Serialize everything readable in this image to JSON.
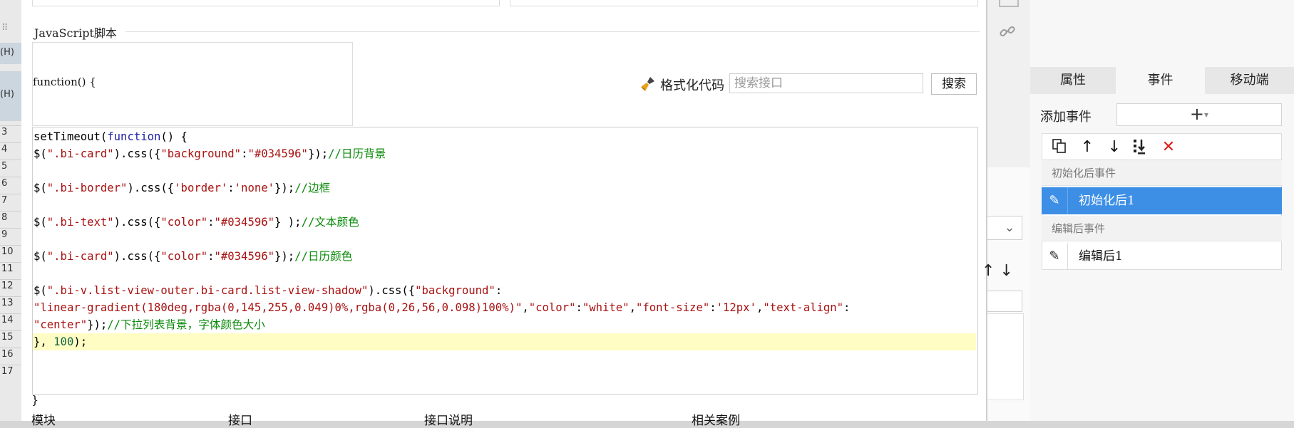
{
  "spreadsheet": {
    "header_cells": [
      "(H)",
      "(H)"
    ],
    "row_numbers": [
      "3",
      "4",
      "5",
      "6",
      "7",
      "8",
      "9",
      "10",
      "11",
      "12",
      "13",
      "14",
      "15",
      "16",
      "17"
    ]
  },
  "dialog": {
    "section_title": "JavaScript脚本",
    "function_signature": "function() {",
    "format_code_label": "格式化代码",
    "search": {
      "placeholder": "搜索接口",
      "value": ""
    },
    "search_button": "搜索",
    "code_lines": [
      [
        [
          "setTimeout(",
          "plain"
        ],
        [
          "function",
          "kw"
        ],
        [
          "() {",
          "plain"
        ]
      ],
      [
        [
          "$(",
          "plain"
        ],
        [
          "\".bi-card\"",
          "str"
        ],
        [
          ").css({",
          "plain"
        ],
        [
          "\"background\"",
          "str"
        ],
        [
          ":",
          "plain"
        ],
        [
          "\"#034596\"",
          "str"
        ],
        [
          "});",
          "plain"
        ],
        [
          "//日历背景",
          "com"
        ]
      ],
      [],
      [
        [
          "$(",
          "plain"
        ],
        [
          "\".bi-border\"",
          "str"
        ],
        [
          ").css({",
          "plain"
        ],
        [
          "'border'",
          "str"
        ],
        [
          ":",
          "plain"
        ],
        [
          "'none'",
          "str"
        ],
        [
          "});",
          "plain"
        ],
        [
          "//边框",
          "com"
        ]
      ],
      [],
      [
        [
          "$(",
          "plain"
        ],
        [
          "\".bi-text\"",
          "str"
        ],
        [
          ").css({",
          "plain"
        ],
        [
          "\"color\"",
          "str"
        ],
        [
          ":",
          "plain"
        ],
        [
          "\"#034596\"",
          "str"
        ],
        [
          "} );",
          "plain"
        ],
        [
          "//文本颜色",
          "com"
        ]
      ],
      [],
      [
        [
          "$(",
          "plain"
        ],
        [
          "\".bi-card\"",
          "str"
        ],
        [
          ").css({",
          "plain"
        ],
        [
          "\"color\"",
          "str"
        ],
        [
          ":",
          "plain"
        ],
        [
          "\"#034596\"",
          "str"
        ],
        [
          "});",
          "plain"
        ],
        [
          "//日历颜色",
          "com"
        ]
      ],
      [],
      [
        [
          "$(",
          "plain"
        ],
        [
          "\".bi-v.list-view-outer.bi-card.list-view-shadow\"",
          "str"
        ],
        [
          ").css({",
          "plain"
        ],
        [
          "\"background\"",
          "str"
        ],
        [
          ":",
          "plain"
        ]
      ],
      [
        [
          "\"linear-gradient(180deg,rgba(0,145,255,0.049)0%,rgba(0,26,56,0.098)100%)\"",
          "str"
        ],
        [
          ",",
          "plain"
        ],
        [
          "\"color\"",
          "str"
        ],
        [
          ":",
          "plain"
        ],
        [
          "\"white\"",
          "str"
        ],
        [
          ",",
          "plain"
        ],
        [
          "\"font-size\"",
          "str"
        ],
        [
          ":",
          "plain"
        ],
        [
          "'12px'",
          "str"
        ],
        [
          ",",
          "plain"
        ],
        [
          "\"text-align\"",
          "str"
        ],
        [
          ":",
          "plain"
        ]
      ],
      [
        [
          "\"center\"",
          "str"
        ],
        [
          "});",
          "plain"
        ],
        [
          "//下拉列表背景，字体颜色大小",
          "com"
        ]
      ],
      [
        [
          "}, ",
          "plain"
        ],
        [
          "100",
          "num"
        ],
        [
          ");",
          "plain"
        ]
      ]
    ],
    "closing_brace": "}",
    "table_headers": [
      "模块",
      "接口",
      "接口说明",
      "相关案例"
    ]
  },
  "right_panel": {
    "tabs": [
      "属性",
      "事件",
      "移动端"
    ],
    "active_tab": "事件",
    "add_event_label": "添加事件",
    "add_event_button": "+",
    "toolbar_icons": [
      "copy-icon",
      "arrow-up-icon",
      "arrow-down-icon",
      "move-bottom-icon",
      "delete-icon"
    ],
    "groups": [
      {
        "title": "初始化后事件",
        "events": [
          {
            "name": "初始化后1",
            "selected": true
          }
        ]
      },
      {
        "title": "编辑后事件",
        "events": [
          {
            "name": "编辑后1",
            "selected": false
          }
        ]
      }
    ]
  },
  "colors": {
    "selection": "#3d8fe6",
    "highlight_line": "#fffdc4",
    "delete_red": "#e02020",
    "code_string": "#aa1111",
    "code_comment": "#0a8a0a",
    "code_keyword": "#1e1ea6"
  }
}
